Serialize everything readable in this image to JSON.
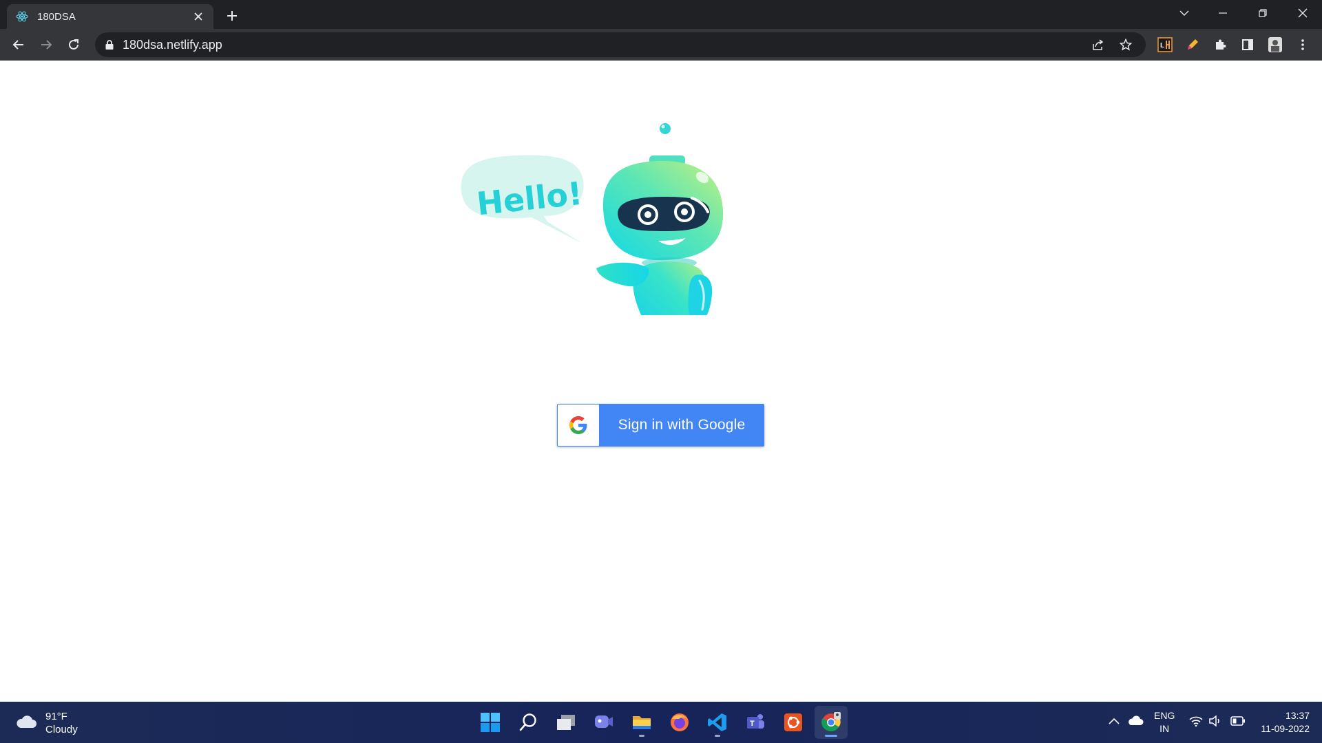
{
  "browser": {
    "tab": {
      "title": "180DSA",
      "favicon": "react-atom-icon"
    },
    "new_tab_icon": "plus-icon",
    "url": "180dsa.netlify.app",
    "extensions": [
      "lighthouse-extension-icon",
      "pen-extension-icon",
      "extensions-puzzle-icon",
      "side-panel-icon",
      "profile-avatar-icon"
    ]
  },
  "page": {
    "illustration": {
      "speech_bubble_text": "Hello!"
    },
    "signin_button": {
      "label": "Sign in with Google",
      "color": "#4285f4"
    }
  },
  "taskbar": {
    "weather": {
      "temperature": "91°F",
      "condition": "Cloudy"
    },
    "apps": [
      "start",
      "search",
      "task-view",
      "chat",
      "file-explorer",
      "firefox",
      "vscode",
      "teams",
      "ubuntu",
      "chrome"
    ],
    "language": {
      "line1": "ENG",
      "line2": "IN"
    },
    "clock": {
      "time": "13:37",
      "date": "11-09-2022"
    }
  }
}
